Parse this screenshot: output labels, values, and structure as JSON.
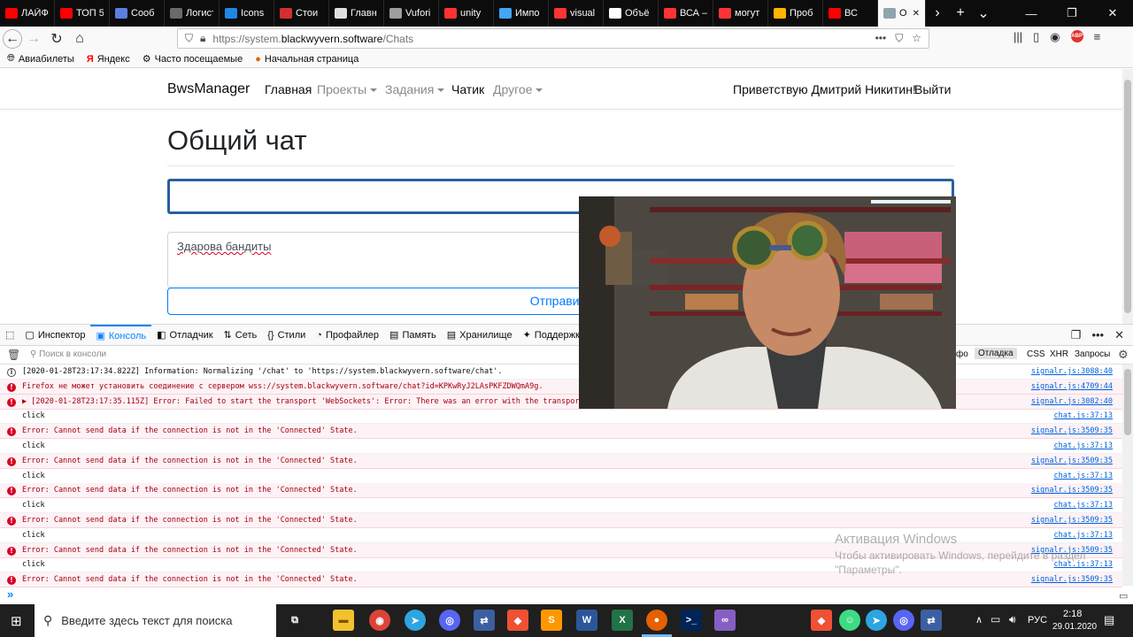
{
  "browser": {
    "tabs": [
      {
        "label": "ЛАЙФ",
        "icon": "youtube-icon",
        "color": "#ff0000"
      },
      {
        "label": "ТОП 5",
        "icon": "youtube-icon",
        "color": "#ff0000"
      },
      {
        "label": "Сооб",
        "icon": "chat-icon",
        "color": "#5b7fde"
      },
      {
        "label": "Логистик",
        "icon": "generic-page-icon",
        "color": "#6a6a6a"
      },
      {
        "label": "Icons",
        "icon": "flag-icon",
        "color": "#1e88e5"
      },
      {
        "label": "Стои",
        "icon": "pdf-icon",
        "color": "#d32f2f"
      },
      {
        "label": "Главн",
        "icon": "document-icon",
        "color": "#e0e0e0"
      },
      {
        "label": "Vufori",
        "icon": "vuforia-icon",
        "color": "#9e9e9e"
      },
      {
        "label": "unity",
        "icon": "yandex-icon",
        "color": "#ff3333"
      },
      {
        "label": "Импо",
        "icon": "image-icon",
        "color": "#42a5f5"
      },
      {
        "label": "visual",
        "icon": "yandex-icon",
        "color": "#ff3333"
      },
      {
        "label": "Объё",
        "icon": "wikipedia-icon",
        "color": "#ffffff"
      },
      {
        "label": "ВСА –",
        "icon": "yandex-icon",
        "color": "#ff3333"
      },
      {
        "label": "могут",
        "icon": "yandex-icon",
        "color": "#ff3333"
      },
      {
        "label": "Проб",
        "icon": "warning-icon",
        "color": "#ffb300"
      },
      {
        "label": "ВС",
        "icon": "youtube-icon",
        "color": "#ff0000"
      },
      {
        "label": "Об",
        "icon": "page-icon",
        "color": "#90a4ae",
        "active": true
      }
    ],
    "url_prefix": "https://system.",
    "url_domain": "blackwyvern.software",
    "url_path": "/Chats",
    "bookmarks": [
      "Авиабилеты",
      "Яндекс",
      "Часто посещаемые",
      "Начальная страница"
    ]
  },
  "site": {
    "brand": "BwsManager",
    "nav": {
      "home": "Главная",
      "projects": "Проекты",
      "tasks": "Задания",
      "chat": "Чатик",
      "other": "Другое"
    },
    "greeting": "Приветствую Дмитрий Никитин!",
    "logout": "Выйти",
    "heading": "Общий чат",
    "message_text": "Здарова бандиты",
    "send_button": "Отправить"
  },
  "devtools": {
    "tabs": [
      "Инспектор",
      "Консоль",
      "Отладчик",
      "Сеть",
      "Стили",
      "Профайлер",
      "Память",
      "Хранилище",
      "Поддержка"
    ],
    "active_tab": "Консоль",
    "filter_placeholder": "Поиск в консоли",
    "filter_buttons": [
      "фо",
      "Отладка",
      "CSS",
      "XHR",
      "Запросы"
    ],
    "logs": [
      {
        "type": "info",
        "text": "[2020-01-28T23:17:34.822Z] Information: Normalizing '/chat' to 'https://system.blackwyvern.software/chat'.",
        "source": "signalr.js:3088:40"
      },
      {
        "type": "error",
        "text": "Firefox не может установить соединение с сервером wss://system.blackwyvern.software/chat?id=KPKwRyJ2LAsPKFZDWQmA9g.",
        "source": "signalr.js:4709:44"
      },
      {
        "type": "error",
        "text": "▶ [2020-01-28T23:17:35.115Z] Error: Failed to start the transport 'WebSockets': Error: There was an error with the transport.",
        "source": "signalr.js:3082:40"
      },
      {
        "type": "log",
        "text": "click",
        "source": "chat.js:37:13"
      },
      {
        "type": "error",
        "text": "Error: Cannot send data if the connection is not in the 'Connected' State.",
        "source": "signalr.js:3509:35"
      },
      {
        "type": "log",
        "text": "click",
        "source": "chat.js:37:13"
      },
      {
        "type": "error",
        "text": "Error: Cannot send data if the connection is not in the 'Connected' State.",
        "source": "signalr.js:3509:35"
      },
      {
        "type": "log",
        "text": "click",
        "source": "chat.js:37:13"
      },
      {
        "type": "error",
        "text": "Error: Cannot send data if the connection is not in the 'Connected' State.",
        "source": "signalr.js:3509:35"
      },
      {
        "type": "log",
        "text": "click",
        "source": "chat.js:37:13"
      },
      {
        "type": "error",
        "text": "Error: Cannot send data if the connection is not in the 'Connected' State.",
        "source": "signalr.js:3509:35"
      },
      {
        "type": "log",
        "text": "click",
        "source": "chat.js:37:13"
      },
      {
        "type": "error",
        "text": "Error: Cannot send data if the connection is not in the 'Connected' State.",
        "source": "signalr.js:3509:35"
      },
      {
        "type": "log",
        "text": "click",
        "source": "chat.js:37:13"
      },
      {
        "type": "error",
        "text": "Error: Cannot send data if the connection is not in the 'Connected' State.",
        "source": "signalr.js:3509:35"
      }
    ]
  },
  "watermark": {
    "title": "Активация Windows",
    "line1": "Чтобы активировать Windows, перейдите в раздел",
    "line2": "\"Параметры\"."
  },
  "taskbar": {
    "search_placeholder": "Введите здесь текст для поиска",
    "language": "РУС",
    "time": "2:18",
    "date": "29.01.2020"
  }
}
